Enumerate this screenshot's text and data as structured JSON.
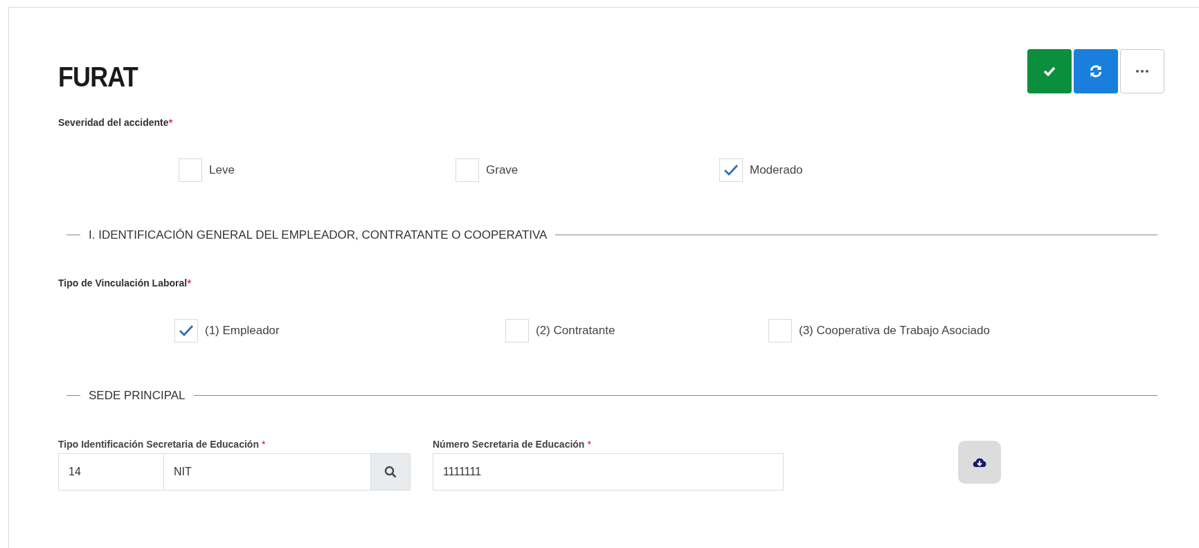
{
  "title": "FURAT",
  "toolbar": [
    {
      "kind": "confirm"
    },
    {
      "kind": "refresh"
    },
    {
      "kind": "more"
    }
  ],
  "sections": [
    {
      "kind": "choices",
      "label": "Severidad del accidente",
      "required_mark": "*",
      "options": [
        {
          "label": "Leve",
          "checked": false
        },
        {
          "label": "Grave",
          "checked": false
        },
        {
          "label": "Moderado",
          "checked": true
        }
      ]
    },
    {
      "kind": "divider",
      "label": "I. IDENTIFICACIÓN GENERAL DEL EMPLEADOR, CONTRATANTE O COOPERATIVA"
    },
    {
      "kind": "choices",
      "label": "Tipo de Vinculación Laboral",
      "required_mark": "*",
      "options": [
        {
          "label": "(1) Empleador",
          "checked": true
        },
        {
          "label": "(2) Contratante",
          "checked": false
        },
        {
          "label": "(3) Cooperativa de Trabajo Asociado",
          "checked": false
        }
      ]
    },
    {
      "kind": "divider",
      "label": "SEDE PRINCIPAL"
    },
    {
      "kind": "fields",
      "tipo": {
        "label": "Tipo Identificación Secretaria de Educación",
        "required_mark": "*",
        "code": "14",
        "name": "NIT"
      },
      "numero": {
        "label": "Número Secretaria de Educación",
        "required_mark": "*",
        "value": "1111111"
      }
    }
  ]
}
